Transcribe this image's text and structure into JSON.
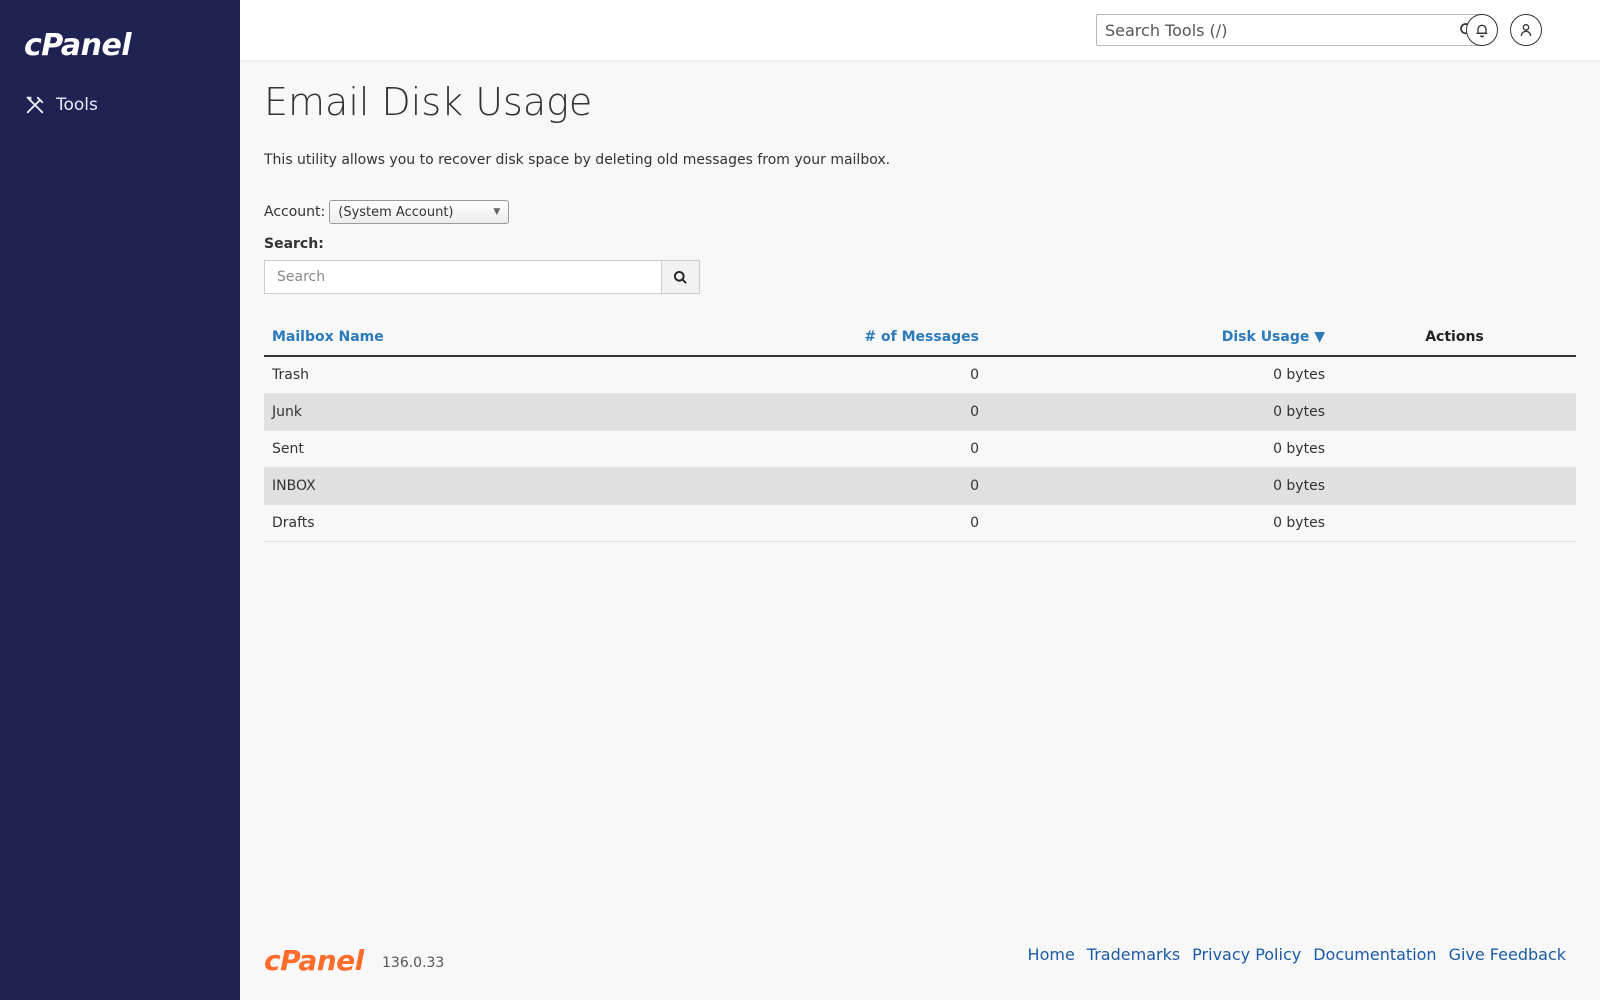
{
  "sidebar": {
    "logo": "cPanel",
    "nav": [
      {
        "label": "Tools",
        "icon": "tools-icon"
      }
    ]
  },
  "header": {
    "search_placeholder": "Search Tools (/)",
    "icons": [
      "search-icon",
      "bell-icon",
      "user-icon"
    ]
  },
  "page": {
    "title": "Email Disk Usage",
    "description": "This utility allows you to recover disk space by deleting old messages from your mailbox.",
    "account_label": "Account:",
    "account_value": "(System Account)",
    "search_label": "Search:",
    "search_placeholder": "Search"
  },
  "table": {
    "columns": [
      "Mailbox Name",
      "# of Messages",
      "Disk Usage ▼",
      "Actions"
    ],
    "rows": [
      {
        "name": "Trash",
        "messages": "0",
        "usage": "0 bytes"
      },
      {
        "name": "Junk",
        "messages": "0",
        "usage": "0 bytes"
      },
      {
        "name": "Sent",
        "messages": "0",
        "usage": "0 bytes"
      },
      {
        "name": "INBOX",
        "messages": "0",
        "usage": "0 bytes"
      },
      {
        "name": "Drafts",
        "messages": "0",
        "usage": "0 bytes"
      }
    ]
  },
  "footer": {
    "logo": "cPanel",
    "version": "136.0.33",
    "links": [
      "Home",
      "Trademarks",
      "Privacy Policy",
      "Documentation",
      "Give Feedback"
    ]
  },
  "colors": {
    "sidebar_bg": "#1f2353",
    "link": "#2a7abd",
    "footer_logo": "#ff6c2c"
  }
}
